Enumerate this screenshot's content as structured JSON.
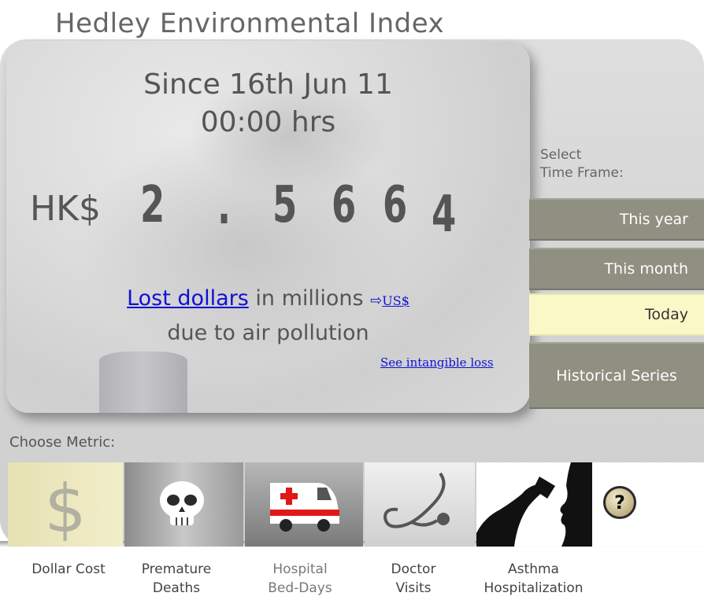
{
  "page_title": "Hedley Environmental Index",
  "counter": {
    "since_line1": "Since 16th Jun 11",
    "since_line2": "00:00 hrs",
    "currency": "HK$",
    "digits": [
      "2",
      ".",
      "5",
      "6",
      "6",
      "4"
    ],
    "lost_link": "Lost dollars",
    "lost_text": "in millions",
    "arrow": "⇨",
    "usd_link": "US$",
    "due_text": "due to air pollution",
    "intangible_link": "See intangible loss"
  },
  "time_frame": {
    "label_line1": "Select",
    "label_line2": "Time Frame:",
    "options": [
      "This year",
      "This month",
      "Today",
      "Historical Series"
    ],
    "selected": "Today"
  },
  "metrics": {
    "label": "Choose Metric:",
    "items": [
      {
        "line1": "Dollar Cost",
        "line2": ""
      },
      {
        "line1": "Premature",
        "line2": "Deaths"
      },
      {
        "line1": "Hospital",
        "line2": "Bed-Days"
      },
      {
        "line1": "Doctor",
        "line2": "Visits"
      },
      {
        "line1": "Asthma",
        "line2": "Hospitalization"
      }
    ],
    "help_symbol": "?"
  },
  "colors": {
    "link": "#1010d6",
    "timeframe_button": "#8f8f82",
    "timeframe_selected": "#fbf8c7"
  }
}
